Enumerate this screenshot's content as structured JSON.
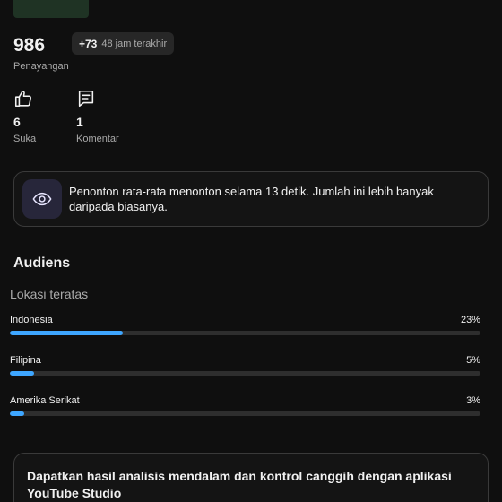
{
  "stats": {
    "views": "986",
    "views_label": "Penayangan",
    "delta_value": "+73",
    "delta_period": "48 jam terakhir"
  },
  "engagement": {
    "likes": "6",
    "likes_label": "Suka",
    "comments": "1",
    "comments_label": "Komentar"
  },
  "insight": {
    "icon": "eye-icon",
    "text": "Penonton rata-rata menonton selama 13 detik. Jumlah ini lebih banyak daripada biasanya."
  },
  "audience": {
    "title": "Audiens",
    "top_locations_title": "Lokasi teratas",
    "locations": [
      {
        "name": "Indonesia",
        "percent_label": "23%",
        "share": 0.23
      },
      {
        "name": "Filipina",
        "percent_label": "5%",
        "share": 0.05
      },
      {
        "name": "Amerika Serikat",
        "percent_label": "3%",
        "share": 0.03
      }
    ]
  },
  "promo": {
    "text": "Dapatkan hasil analisis mendalam dan kontrol canggih dengan aplikasi YouTube Studio"
  },
  "colors": {
    "background": "#0f0f0f",
    "accent_bar": "#3ea6ff",
    "muted_text": "#aaaaaa"
  }
}
